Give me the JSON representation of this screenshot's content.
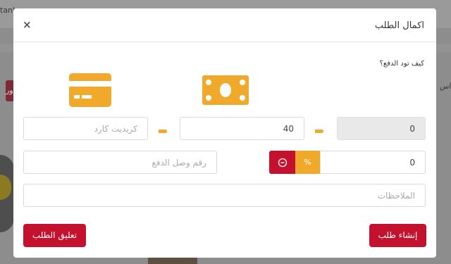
{
  "background": {
    "tab_text": "tanb",
    "side_button": "ور",
    "side_text": "اس"
  },
  "modal": {
    "title": "اكمال الطلب",
    "close_symbol": "×",
    "question": "كيف تود الدفع؟",
    "fields": {
      "remaining_value": "0",
      "cash_value": "40",
      "card_placeholder": "كريديت كارد",
      "discount_value": "0",
      "receipt_placeholder": "رقم وصل الدفع",
      "notes_placeholder": "الملاحظات"
    },
    "percent_label": "%",
    "create_button": "إنشاء طلب",
    "suspend_button": "تعليق الطلب"
  },
  "colors": {
    "accent_orange": "#f0a92a",
    "primary_red": "#c4122e"
  },
  "icons": {
    "card": "credit-card-icon",
    "cash": "cash-icon",
    "pointer": "pointing-hand-icon",
    "minus": "minus-circle-icon"
  }
}
